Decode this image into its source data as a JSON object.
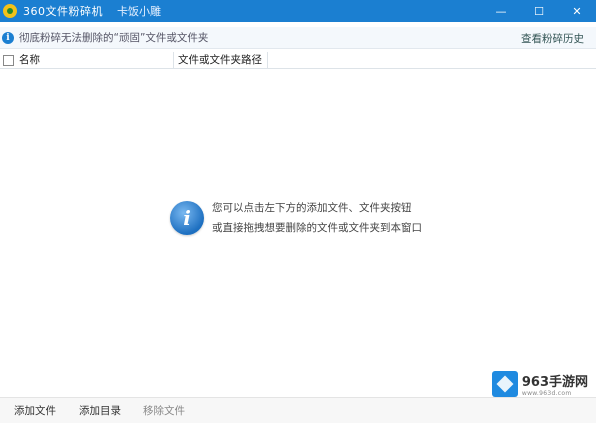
{
  "window": {
    "title": "360文件粉碎机",
    "subtitle": "卡饭小雕",
    "controls": {
      "minimize": "—",
      "maximize": "☐",
      "close": "✕"
    }
  },
  "notice": {
    "text": "彻底粉碎无法删除的“顽固”文件或文件夹",
    "history_link": "查看粉碎历史"
  },
  "table": {
    "columns": [
      "名称",
      "文件或文件夹路径"
    ]
  },
  "empty_state": {
    "line1": "您可以点击左下方的添加文件、文件夹按钮",
    "line2": "或直接拖拽想要删除的文件或文件夹到本窗口"
  },
  "footer": {
    "add_file": "添加文件",
    "add_dir": "添加目录",
    "remove_file": "移除文件"
  },
  "watermark": {
    "title": "963手游网",
    "url": "www.963d.com"
  },
  "colors": {
    "titlebar": "#1b7fd1",
    "accent": "#1d6fc0"
  }
}
